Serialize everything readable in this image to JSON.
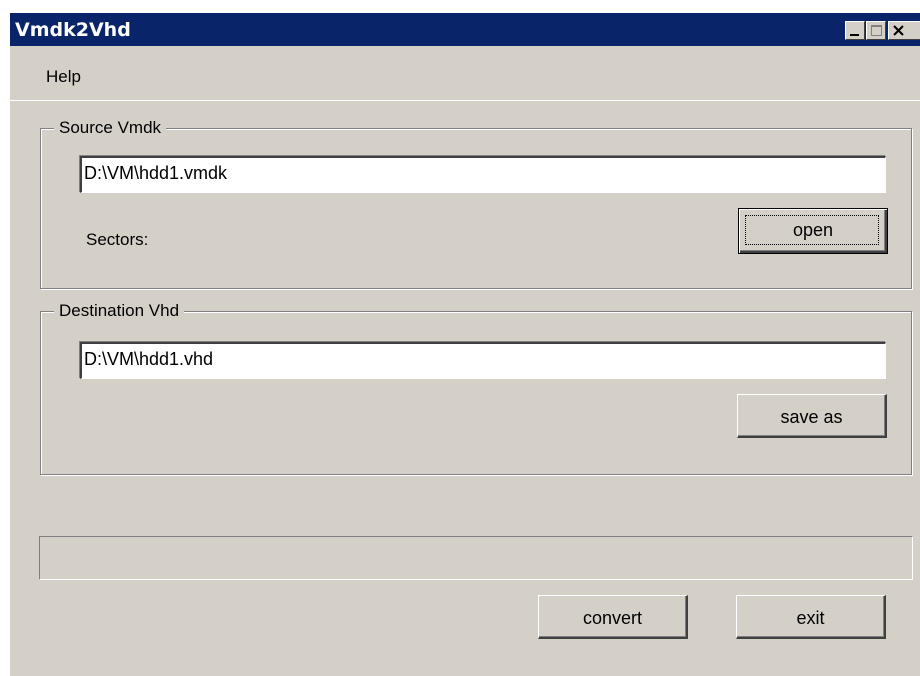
{
  "window": {
    "title": "Vmdk2Vhd",
    "title_bar_color": "#0a246a",
    "face_color": "#d4d0c8",
    "controls": [
      "minimize-icon",
      "maximize-icon",
      "close-icon"
    ]
  },
  "menu": {
    "items": [
      {
        "label": "Help"
      }
    ]
  },
  "source": {
    "group_label": "Source Vmdk",
    "path_value": "D:\\VM\\hdd1.vmdk",
    "sectors_label": "Sectors:",
    "open_label": "open"
  },
  "destination": {
    "group_label": "Destination Vhd",
    "path_value": "D:\\VM\\hdd1.vhd",
    "save_as_label": "save as"
  },
  "progress": {
    "value": 0
  },
  "actions": {
    "convert_label": "convert",
    "exit_label": "exit"
  }
}
